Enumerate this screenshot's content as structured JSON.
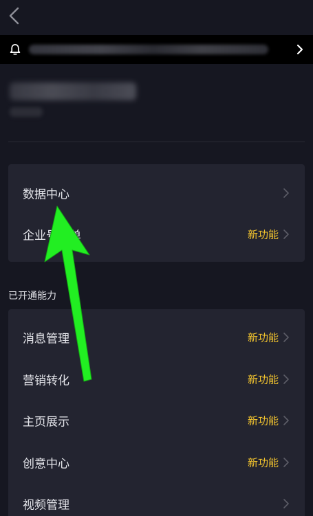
{
  "nav": {
    "back_icon": "chevron-left-icon"
  },
  "notice": {
    "bell_icon": "bell-icon",
    "chevron_icon": "chevron-right-icon"
  },
  "menu_top": [
    {
      "label": "数据中心",
      "badge": ""
    },
    {
      "label": "企业号菜单",
      "badge": "新功能"
    }
  ],
  "section": {
    "title": "已开通能力"
  },
  "menu_enabled": [
    {
      "label": "消息管理",
      "badge": "新功能"
    },
    {
      "label": "营销转化",
      "badge": "新功能"
    },
    {
      "label": "主页展示",
      "badge": "新功能"
    },
    {
      "label": "创意中心",
      "badge": "新功能"
    },
    {
      "label": "视频管理",
      "badge": ""
    }
  ],
  "colors": {
    "background": "#161721",
    "card": "#232430",
    "text": "#e4e5ea",
    "badge": "#f2c32e",
    "annotation_arrow": "#22ee22"
  }
}
